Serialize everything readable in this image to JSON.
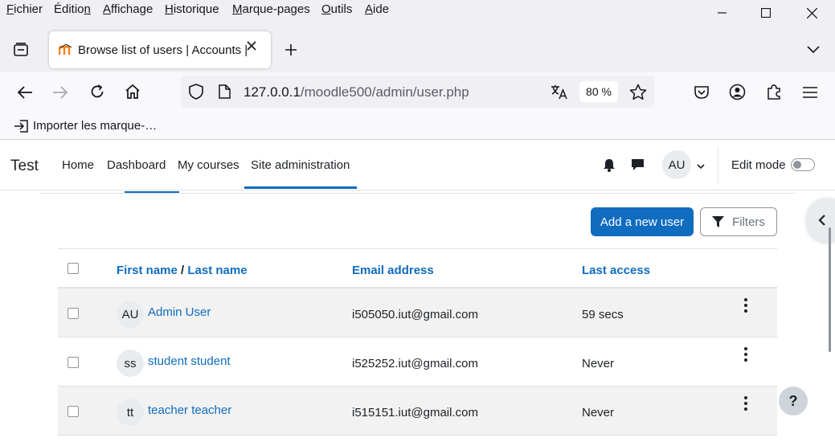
{
  "browser": {
    "menu": [
      {
        "label": "Fichier",
        "key": "F"
      },
      {
        "label": "Édition",
        "key": "n"
      },
      {
        "label": "Affichage",
        "key": "A"
      },
      {
        "label": "Historique",
        "key": "H"
      },
      {
        "label": "Marque-pages",
        "key": "M"
      },
      {
        "label": "Outils",
        "key": "O"
      },
      {
        "label": "Aide",
        "key": "A"
      }
    ],
    "tab_title": "Browse list of users | Accounts | Site administration",
    "url_host": "127.0.0.1",
    "url_path": "/moodle500/admin/user.php",
    "zoom": "80 %",
    "bookmark": "Importer les marque-…"
  },
  "moodle": {
    "site_name": "Test",
    "nav": [
      {
        "label": "Home"
      },
      {
        "label": "Dashboard"
      },
      {
        "label": "My courses"
      },
      {
        "label": "Site administration"
      }
    ],
    "user_initials": "AU",
    "edit_mode_label": "Edit mode",
    "add_user_label": "Add a new user",
    "filters_label": "Filters",
    "help_label": "?"
  },
  "table": {
    "headers": {
      "first_name": "First name",
      "separator": "/",
      "last_name": "Last name",
      "email": "Email address",
      "last_access": "Last access"
    },
    "rows": [
      {
        "initials": "AU",
        "name": "Admin User",
        "email": "i505050.iut@gmail.com",
        "last_access": "59 secs"
      },
      {
        "initials": "ss",
        "name": "student student",
        "email": "i525252.iut@gmail.com",
        "last_access": "Never"
      },
      {
        "initials": "tt",
        "name": "teacher teacher",
        "email": "i515151.iut@gmail.com",
        "last_access": "Never"
      }
    ]
  },
  "colors": {
    "brand_blue": "#0f6cbf",
    "stripe": "#f2f2f2"
  }
}
